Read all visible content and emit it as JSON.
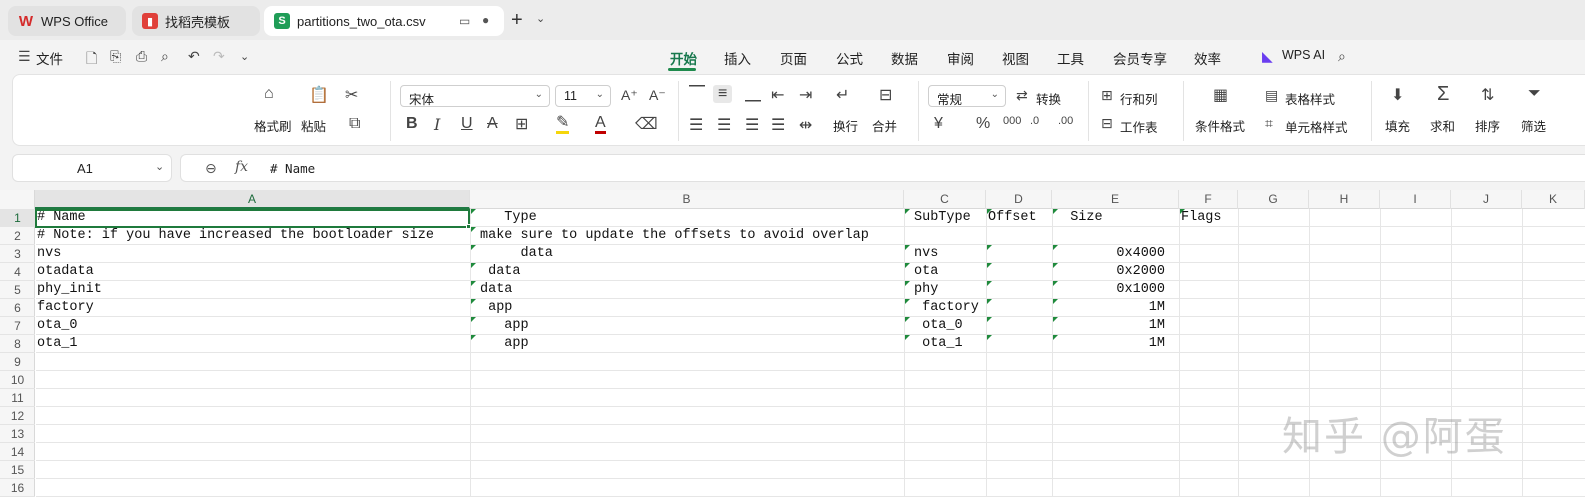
{
  "tabs": [
    {
      "label": "WPS Office"
    },
    {
      "label": "找稻壳模板"
    },
    {
      "label": "partitions_two_ota.csv"
    }
  ],
  "menu": {
    "file": "文件",
    "items": [
      "开始",
      "插入",
      "页面",
      "公式",
      "数据",
      "审阅",
      "视图",
      "工具",
      "会员专享",
      "效率"
    ],
    "wps_ai": "WPS AI"
  },
  "ribbon": {
    "format_painter": "格式刷",
    "paste": "粘贴",
    "font_name": "宋体",
    "font_size": "11",
    "wrap": "换行",
    "merge": "合并",
    "number_format": "常规",
    "convert": "转换",
    "row_col": "行和列",
    "worksheet": "工作表",
    "cond_format": "条件格式",
    "table_style": "表格样式",
    "cell_style": "单元格样式",
    "fill": "填充",
    "sum": "求和",
    "sort": "排序",
    "filter": "筛选",
    "font_color": "#c00000",
    "highlight_color": "#f5d60c"
  },
  "formula_bar": {
    "cell_ref": "A1",
    "fx": "fx",
    "content": "# Name"
  },
  "columns": [
    "A",
    "B",
    "C",
    "D",
    "E",
    "F",
    "G",
    "H",
    "I",
    "J",
    "K"
  ],
  "rows": [
    "1",
    "2",
    "3",
    "4",
    "5",
    "6",
    "7",
    "8",
    "9",
    "10",
    "11",
    "12",
    "13",
    "14",
    "15",
    "16"
  ],
  "cells": {
    "r1": [
      "# Name",
      "   Type",
      "SubType",
      "Offset",
      "  Size",
      "Flags"
    ],
    "r2": [
      "# Note: if you have increased the bootloader size",
      "make sure to update the offsets to avoid overlap"
    ],
    "r3": [
      "nvs",
      "     data",
      "nvs",
      "",
      "0x4000"
    ],
    "r4": [
      "otadata",
      " data",
      "ota",
      "",
      "0x2000"
    ],
    "r5": [
      "phy_init",
      "data",
      "phy",
      "",
      "0x1000"
    ],
    "r6": [
      "factory",
      " app",
      " factory",
      "",
      "1M"
    ],
    "r7": [
      "ota_0",
      "   app",
      " ota_0",
      "",
      "1M"
    ],
    "r8": [
      "ota_1",
      "   app",
      " ota_1",
      "",
      "1M"
    ]
  },
  "watermark": "知乎 @阿蛋"
}
